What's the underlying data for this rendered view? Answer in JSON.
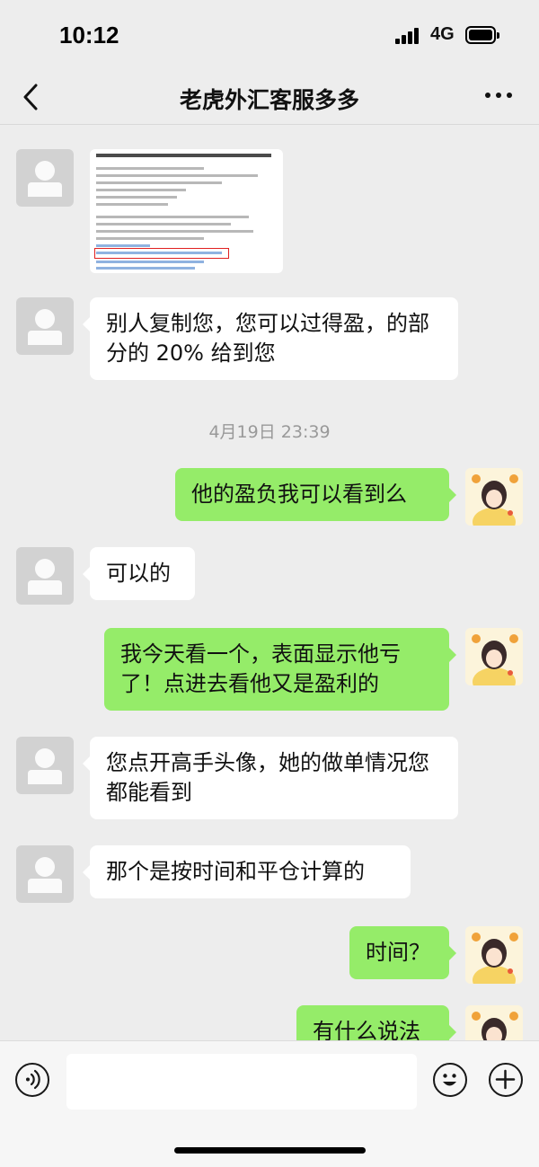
{
  "status_bar": {
    "time": "10:12",
    "network": "4G"
  },
  "header": {
    "title": "老虎外汇客服多多"
  },
  "messages": [
    {
      "text": "别人复制您，您可以过得盈，的部分的 20% 给到您"
    },
    {
      "text": "他的盈负我可以看到么"
    },
    {
      "text": "可以的"
    },
    {
      "text": "我今天看一个，表面显示他亏了！点进去看他又是盈利的"
    },
    {
      "text": "您点开高手头像，她的做单情况您都能看到"
    },
    {
      "text": "那个是按时间和平仓计算的"
    },
    {
      "text": "时间？"
    },
    {
      "text": "有什么说法"
    }
  ],
  "timestamp": "4月19日 23:39",
  "input": {
    "value": ""
  }
}
